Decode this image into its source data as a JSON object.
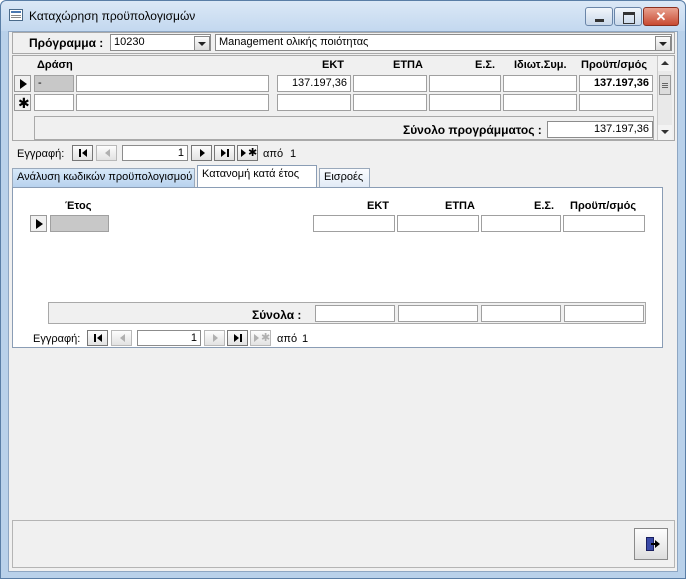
{
  "window": {
    "title": "Καταχώρηση προϋπολογισμών"
  },
  "program": {
    "label": "Πρόγραμμα :",
    "code": "10230",
    "name": "Management ολικής ποιότητας"
  },
  "main_grid": {
    "headers": [
      "Δράση",
      "ΕΚΤ",
      "ΕΤΠΑ",
      "Ε.Σ.",
      "Ιδιωτ.Συμ.",
      "Προϋπ/σμός"
    ],
    "row1": {
      "code": "-",
      "action": "",
      "ekt": "137.197,36",
      "etpa": "",
      "es": "",
      "idiot": "",
      "budget": "137.197,36"
    },
    "total_label": "Σύνολο προγράμματος :",
    "total_value": "137.197,36"
  },
  "main_nav": {
    "label": "Εγγραφή:",
    "record": "1",
    "of_label": "από",
    "total": "1"
  },
  "tabs": [
    {
      "label": "Ανάλυση κωδικών προϋπολογισμού"
    },
    {
      "label": "Κατανομή κατά έτος"
    },
    {
      "label": "Εισροές"
    }
  ],
  "year_grid": {
    "headers": [
      "Έτος",
      "ΕΚΤ",
      "ΕΤΠΑ",
      "Ε.Σ.",
      "Προϋπ/σμός"
    ],
    "totals_label": "Σύνολα :"
  },
  "sub_nav": {
    "label": "Εγγραφή:",
    "record": "1",
    "of_label": "από",
    "total": "1"
  }
}
